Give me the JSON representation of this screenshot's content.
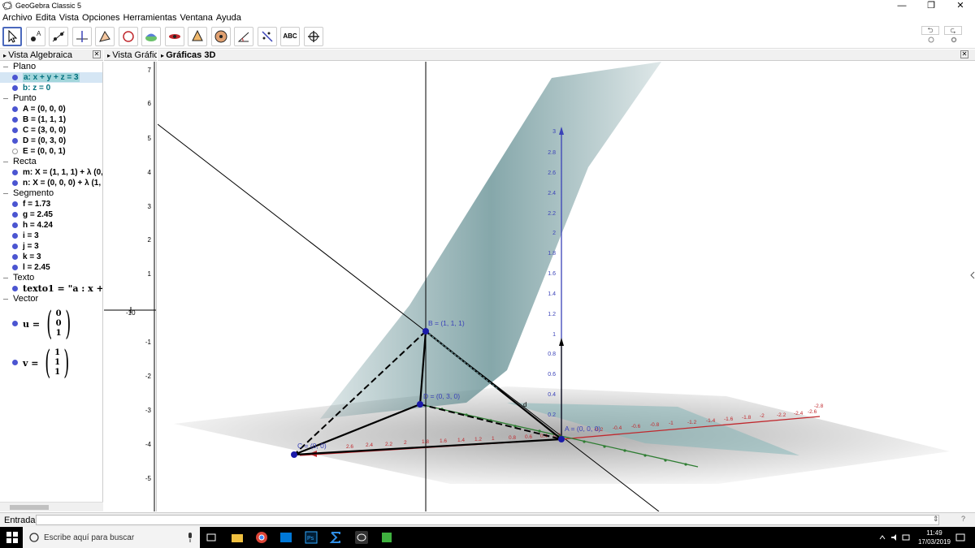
{
  "window": {
    "title": "GeoGebra Classic 5",
    "min": "—",
    "restore": "❐",
    "close": "✕"
  },
  "menu": [
    "Archivo",
    "Edita",
    "Vista",
    "Opciones",
    "Herramientas",
    "Ventana",
    "Ayuda"
  ],
  "toolbar": {
    "text_tool": "ABC",
    "undo": "⮌",
    "redo": "⮎"
  },
  "algebra": {
    "header": "Vista Algebraica",
    "close": "✕",
    "plano": {
      "label": "Plano",
      "a": "a: x + y + z = 3",
      "b": "b: z = 0"
    },
    "punto": {
      "label": "Punto",
      "A": "A = (0, 0, 0)",
      "B": "B = (1, 1, 1)",
      "C": "C = (3, 0, 0)",
      "D": "D = (0, 3, 0)",
      "E": "E = (0, 0, 1)"
    },
    "recta": {
      "label": "Recta",
      "m": "m: X = (1, 1, 1) + λ (0,",
      "n": "n: X = (0, 0, 0) + λ (1, ·"
    },
    "segmento": {
      "label": "Segmento",
      "f": "f = 1.73",
      "g": "g = 2.45",
      "h": "h = 4.24",
      "i": "i = 3",
      "j": "j = 3",
      "k": "k = 3",
      "l": "l = 2.45"
    },
    "texto": {
      "label": "Texto",
      "texto1": "texto1 = \"a : x +"
    },
    "vector": {
      "label": "Vector",
      "u_name": "u =",
      "u": [
        "0",
        "0",
        "1"
      ],
      "v_name": "v =",
      "v": [
        "1",
        "1",
        "1"
      ]
    }
  },
  "graphics2": {
    "header": "Vista Gráfic",
    "ticks": [
      "7",
      "6",
      "5",
      "4",
      "3",
      "2",
      "1",
      "-1",
      "-2",
      "-3",
      "-4",
      "-5"
    ],
    "x_tick": "-10"
  },
  "graphics3d": {
    "header": "Gráficas 3D",
    "labels": {
      "B": "B = (1, 1, 1)",
      "D": "D = (0, 3, 0)",
      "A": "A = (0, 0, 0)",
      "C": "C = (0, 0)",
      "d": "d"
    },
    "z_ticks": [
      "3",
      "2.8",
      "2.6",
      "2.4",
      "2.2",
      "2",
      "1.8",
      "1.6",
      "1.4",
      "1.2",
      "1",
      "0.8",
      "0.6",
      "0.4",
      "0.2"
    ],
    "x_ticks": [
      "-0.2",
      "-0.4",
      "-0.6",
      "-0.8",
      "-1",
      "-1.2",
      "-1.4",
      "-1.6",
      "-1.8",
      "-2",
      "-2.2",
      "-2.4",
      "-2.6",
      "-2.8"
    ],
    "x_ticks_pos": [
      "2.6",
      "2.4",
      "2.2",
      "2",
      "1.8",
      "1.6",
      "1.4",
      "1.2",
      "1",
      "0.8",
      "0.6",
      "0.4",
      "0.2"
    ],
    "colors": {
      "plane": "#5d8a8e",
      "ground": "#9a9a9a",
      "x_axis": "#c0282d",
      "y_axis": "#2e7d32",
      "z_axis": "#3a42b8",
      "point": "#1a1aa8"
    }
  },
  "input": {
    "label": "Entrada:",
    "help": "?",
    "arrow": "⇕"
  },
  "taskbar": {
    "search": "Escribe aquí para buscar",
    "time": "11:49",
    "date": "17/03/2019"
  }
}
